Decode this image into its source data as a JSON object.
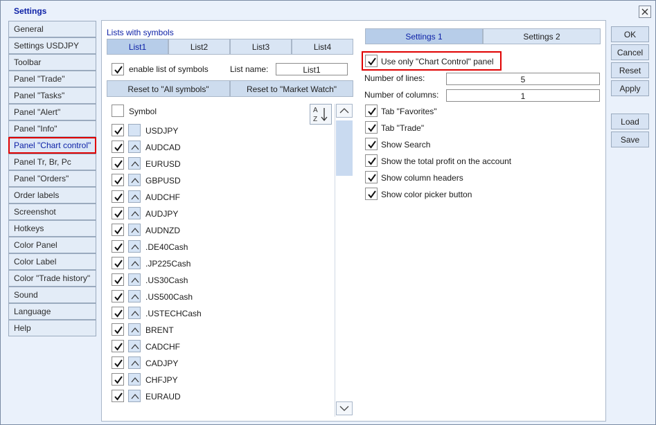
{
  "window": {
    "title": "Settings"
  },
  "nav": [
    "General",
    "Settings USDJPY",
    "Toolbar",
    "Panel \"Trade\"",
    "Panel \"Tasks\"",
    "Panel \"Alert\"",
    "Panel \"Info\"",
    "Panel \"Chart control\"",
    "Panel Tr, Br, Pc",
    "Panel \"Orders\"",
    "Order labels",
    "Screenshot",
    "Hotkeys",
    "Color Panel",
    "Color Label",
    "Color \"Trade history\"",
    "Sound",
    "Language",
    "Help"
  ],
  "nav_active": "Panel \"Chart control\"",
  "lists": {
    "header": "Lists with symbols",
    "tabs": [
      "List1",
      "List2",
      "List3",
      "List4"
    ],
    "enable_label": "enable list of symbols",
    "list_name_label": "List name:",
    "list_name_value": "List1",
    "reset_all": "Reset to \"All symbols\"",
    "reset_market": "Reset to \"Market Watch\"",
    "symbol_header": "Symbol",
    "sort_az": "A\nZ",
    "symbols": [
      "USDJPY",
      "AUDCAD",
      "EURUSD",
      "GBPUSD",
      "AUDCHF",
      "AUDJPY",
      "AUDNZD",
      ".DE40Cash",
      ".JP225Cash",
      ".US30Cash",
      ".US500Cash",
      ".USTECHCash",
      "BRENT",
      "CADCHF",
      "CADJPY",
      "CHFJPY",
      "EURAUD"
    ]
  },
  "settings": {
    "tabs": [
      "Settings 1",
      "Settings 2"
    ],
    "use_only_label": "Use only \"Chart Control\" panel",
    "lines_label": "Number of lines:",
    "lines_value": "5",
    "columns_label": "Number of columns:",
    "columns_value": "1",
    "options": [
      "Tab \"Favorites\"",
      "Tab \"Trade\"",
      "Show Search",
      "Show the total profit on the account",
      "Show column headers",
      "Show color picker button"
    ]
  },
  "buttons": {
    "ok": "OK",
    "cancel": "Cancel",
    "reset": "Reset",
    "apply": "Apply",
    "load": "Load",
    "save": "Save"
  },
  "colors": {
    "accent": "#0b1fa6",
    "highlight": "#e00000",
    "bg": "#eaf1fb"
  }
}
